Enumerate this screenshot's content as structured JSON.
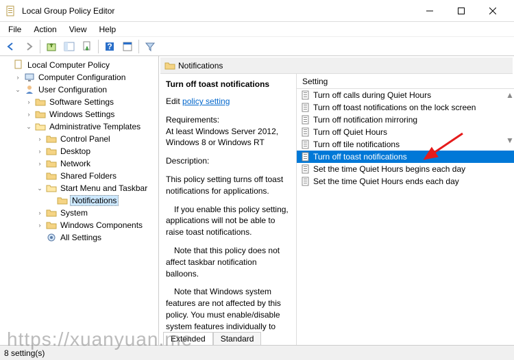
{
  "window": {
    "title": "Local Group Policy Editor"
  },
  "menu": {
    "file": "File",
    "action": "Action",
    "view": "View",
    "help": "Help"
  },
  "tree": {
    "root": "Local Computer Policy",
    "cc": "Computer Configuration",
    "uc": "User Configuration",
    "ss": "Software Settings",
    "ws": "Windows Settings",
    "at": "Administrative Templates",
    "cp": "Control Panel",
    "desktop": "Desktop",
    "network": "Network",
    "sf": "Shared Folders",
    "smt": "Start Menu and Taskbar",
    "notif": "Notifications",
    "system": "System",
    "wc": "Windows Components",
    "as": "All Settings"
  },
  "crumb": {
    "label": "Notifications"
  },
  "desc": {
    "title": "Turn off toast notifications",
    "edit_prefix": "Edit",
    "edit_link": "policy setting",
    "req_label": "Requirements:",
    "req_body": "At least Windows Server 2012, Windows 8 or Windows RT",
    "desc_label": "Description:",
    "p1": "This policy setting turns off toast notifications for applications.",
    "p2": "If you enable this policy setting, applications will not be able to raise toast notifications.",
    "p3": "Note that this policy does not affect taskbar notification balloons.",
    "p4": "Note that Windows system features are not affected by this policy.  You must enable/disable system features individually to"
  },
  "list": {
    "header": "Setting",
    "r0": "Turn off calls during Quiet Hours",
    "r1": "Turn off toast notifications on the lock screen",
    "r2": "Turn off notification mirroring",
    "r3": "Turn off Quiet Hours",
    "r4": "Turn off tile notifications",
    "r5": "Turn off toast notifications",
    "r6": "Set the time Quiet Hours begins each day",
    "r7": "Set the time Quiet Hours ends each day"
  },
  "tabs": {
    "extended": "Extended",
    "standard": "Standard"
  },
  "status": {
    "text": "8 setting(s)"
  },
  "watermark": "https://xuanyuan.me"
}
